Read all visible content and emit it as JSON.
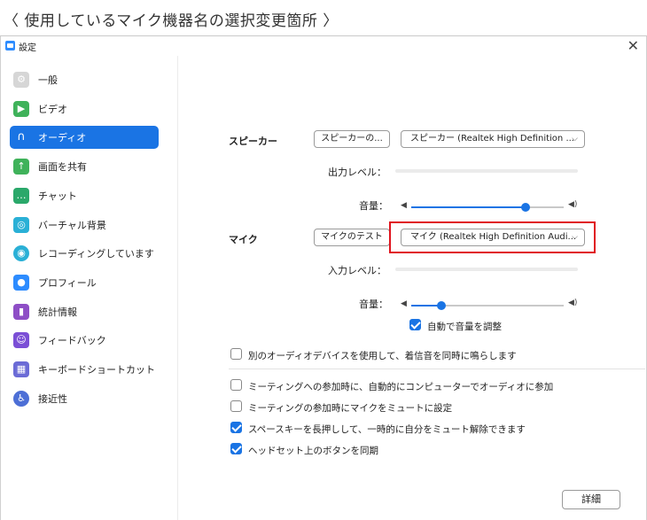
{
  "caption": "〈 使用しているマイク機器名の選択変更箇所 〉",
  "window": {
    "title": "設定",
    "close": "✕"
  },
  "colors": {
    "accent": "#1a74e4",
    "highlight": "#e0141e"
  },
  "sidebar": {
    "items": [
      {
        "label": "一般",
        "icon": "gear-icon",
        "glyph": "⚙",
        "color": "#d6d6d6"
      },
      {
        "label": "ビデオ",
        "icon": "video-camera-icon",
        "glyph": "▶",
        "color": "#3fb25a"
      },
      {
        "label": "オーディオ",
        "icon": "headphones-icon",
        "glyph": "∩",
        "color": "#1a74e4",
        "active": true
      },
      {
        "label": "画面を共有",
        "icon": "share-screen-icon",
        "glyph": "↑",
        "color": "#3fb25a"
      },
      {
        "label": "チャット",
        "icon": "chat-bubble-icon",
        "glyph": "…",
        "color": "#2aa86a"
      },
      {
        "label": "バーチャル背景",
        "icon": "virtual-background-icon",
        "glyph": "◎",
        "color": "#2ab0d6"
      },
      {
        "label": "レコーディングしています",
        "icon": "recording-icon",
        "glyph": "◉",
        "color": "#2ab0d6"
      },
      {
        "label": "プロフィール",
        "icon": "profile-icon",
        "glyph": "●",
        "color": "#2d8cff"
      },
      {
        "label": "統計情報",
        "icon": "statistics-icon",
        "glyph": "▮",
        "color": "#8e4ec6"
      },
      {
        "label": "フィードバック",
        "icon": "feedback-smiley-icon",
        "glyph": "☺",
        "color": "#7b4fd6"
      },
      {
        "label": "キーボードショートカット",
        "icon": "keyboard-icon",
        "glyph": "▦",
        "color": "#6b6bd6"
      },
      {
        "label": "接近性",
        "icon": "accessibility-icon",
        "glyph": "♿",
        "color": "#4d6fd6"
      }
    ]
  },
  "speaker": {
    "label": "スピーカー",
    "test_button": "スピーカーの...",
    "device": "スピーカー (Realtek High Definition ...",
    "output_level_label": "出力レベル：",
    "volume_label": "音量：",
    "volume": 0.75
  },
  "mic": {
    "label": "マイク",
    "test_button": "マイクのテスト",
    "device": "マイク (Realtek High Definition Audi...",
    "input_level_label": "入力レベル：",
    "volume_label": "音量：",
    "volume": 0.2,
    "auto_adjust_label": "自動で音量を調整",
    "auto_adjust": true
  },
  "options": [
    {
      "label": "別のオーディオデバイスを使用して、着信音を同時に鳴らします",
      "checked": false
    },
    {
      "label": "ミーティングへの参加時に、自動的にコンピューターでオーディオに参加",
      "checked": false
    },
    {
      "label": "ミーティングの参加時にマイクをミュートに設定",
      "checked": false
    },
    {
      "label": "スペースキーを長押しして、一時的に自分をミュート解除できます",
      "checked": true
    },
    {
      "label": "ヘッドセット上のボタンを同期",
      "checked": true
    }
  ],
  "advanced_button": "詳細"
}
